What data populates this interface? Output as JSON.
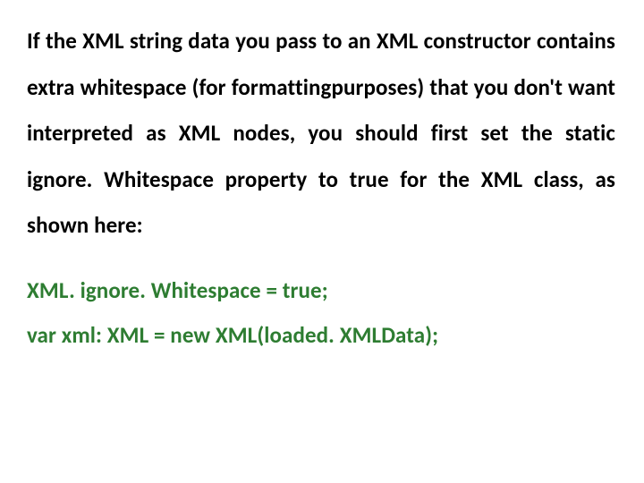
{
  "paragraph": "If the XML string data you pass to an XML constructor contains extra whitespace (for formattingpurposes) that you don't want interpreted as XML nodes, you should first set the static ignore. Whitespace property to true for the XML class, as shown here:",
  "code": {
    "line1": "XML. ignore. Whitespace = true;",
    "line2": "var xml: XML = new XML(loaded. XMLData);"
  }
}
